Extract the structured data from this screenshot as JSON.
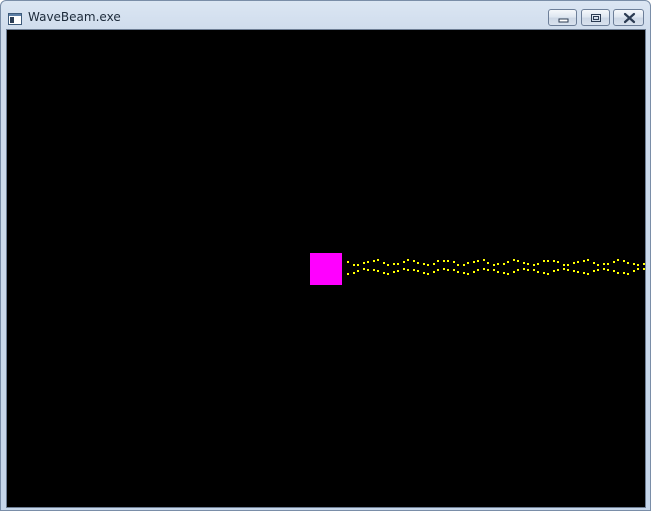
{
  "window": {
    "title": "WaveBeam.exe",
    "icon": "application-window-icon"
  },
  "caption_buttons": {
    "minimize_icon": "minimize-icon",
    "restore_icon": "restore-icon",
    "close_icon": "close-icon"
  },
  "scene": {
    "background_color": "#000000",
    "player_color": "#ff00ff",
    "beam_color": "#ffff00"
  }
}
